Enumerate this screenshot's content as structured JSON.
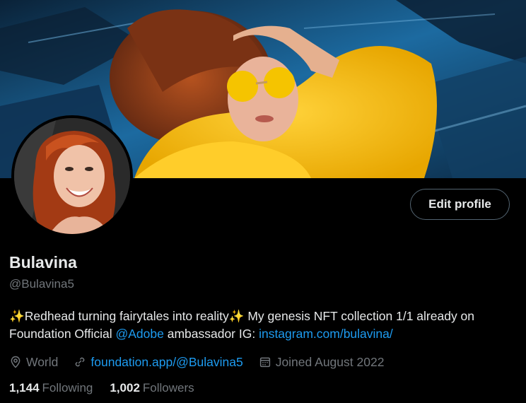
{
  "profile": {
    "display_name": "Bulavina",
    "handle": "@Bulavina5",
    "edit_button_label": "Edit profile",
    "bio": {
      "part1": "✨Redhead turning fairytales into reality✨ My genesis NFT collection 1/1 already on Foundation  Official ",
      "mention": "@Adobe",
      "part2": " ambassador IG: ",
      "link": "instagram.com/bulavina/"
    },
    "location": "World",
    "website": "foundation.app/@Bulavina5",
    "joined": "Joined August 2022",
    "following_count": "1,144",
    "following_label": "Following",
    "followers_count": "1,002",
    "followers_label": "Followers"
  },
  "icons": {
    "location": "location-pin-icon",
    "website": "link-icon",
    "joined": "calendar-icon"
  },
  "colors": {
    "background": "#000000",
    "text": "#e7e9ea",
    "secondary": "#71767b",
    "link": "#1d9bf0",
    "button_border": "#536471"
  }
}
